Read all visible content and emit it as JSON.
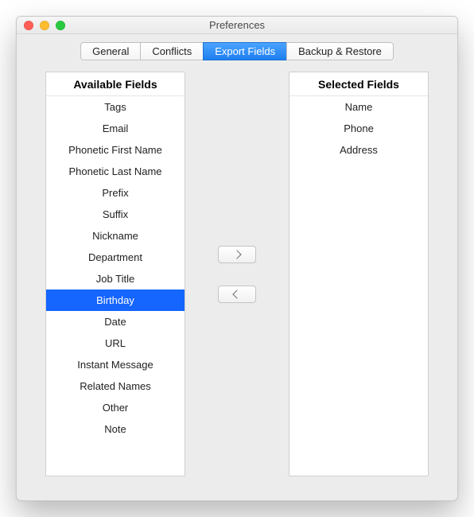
{
  "window": {
    "title": "Preferences"
  },
  "tabs": [
    {
      "label": "General",
      "active": false
    },
    {
      "label": "Conflicts",
      "active": false
    },
    {
      "label": "Export Fields",
      "active": true
    },
    {
      "label": "Backup & Restore",
      "active": false
    }
  ],
  "panels": {
    "available": {
      "title": "Available Fields",
      "items": [
        {
          "label": "Tags",
          "selected": false
        },
        {
          "label": "Email",
          "selected": false
        },
        {
          "label": "Phonetic First Name",
          "selected": false
        },
        {
          "label": "Phonetic Last Name",
          "selected": false
        },
        {
          "label": "Prefix",
          "selected": false
        },
        {
          "label": "Suffix",
          "selected": false
        },
        {
          "label": "Nickname",
          "selected": false
        },
        {
          "label": "Department",
          "selected": false
        },
        {
          "label": "Job Title",
          "selected": false
        },
        {
          "label": "Birthday",
          "selected": true
        },
        {
          "label": "Date",
          "selected": false
        },
        {
          "label": "URL",
          "selected": false
        },
        {
          "label": "Instant Message",
          "selected": false
        },
        {
          "label": "Related Names",
          "selected": false
        },
        {
          "label": "Other",
          "selected": false
        },
        {
          "label": "Note",
          "selected": false
        }
      ]
    },
    "selected": {
      "title": "Selected Fields",
      "items": [
        {
          "label": "Name",
          "selected": false
        },
        {
          "label": "Phone",
          "selected": false
        },
        {
          "label": "Address",
          "selected": false
        }
      ]
    }
  },
  "buttons": {
    "move_right_icon": "chevron-right-icon",
    "move_left_icon": "chevron-left-icon"
  }
}
